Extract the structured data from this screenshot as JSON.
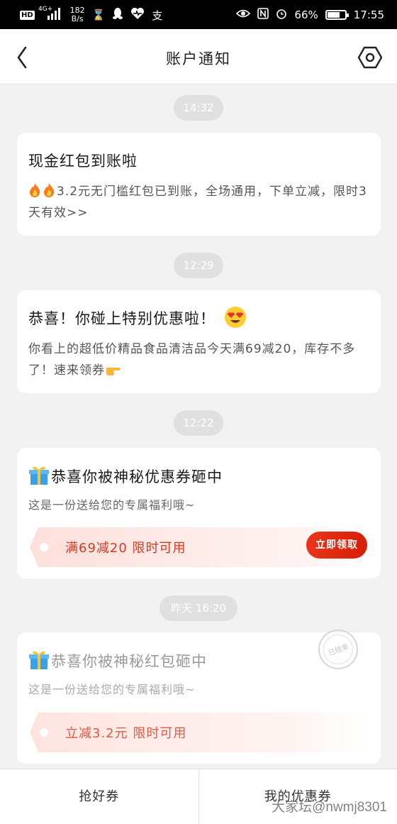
{
  "status_bar": {
    "hd": "HD",
    "network": "4G+",
    "speed_value": "182",
    "speed_unit": "B/s",
    "alipay": "支",
    "battery_text": "66%",
    "battery_level": 0.66,
    "time": "17:55"
  },
  "nav": {
    "title": "账户通知"
  },
  "messages": [
    {
      "time": "14:32",
      "title": "现金红包到账啦",
      "body": "3.2元无门槛红包已到账，全场通用，下单立减，限时3天有效>>"
    },
    {
      "time": "12:29",
      "title": "恭喜！你碰上特别优惠啦！",
      "body": "你看上的超低价精品食品清洁品今天满69减20，库存不多了！速来领券"
    },
    {
      "time": "12:22",
      "title": "恭喜你被神秘优惠券砸中",
      "body": "这是一份送给您的专属福利哦~",
      "coupon": "满69减20 限时可用",
      "button": "立即领取"
    },
    {
      "time": "昨天 16:20",
      "title": "恭喜你被神秘红包砸中",
      "body": "这是一份送给您的专属福利哦~",
      "coupon": "立减3.2元 限时可用",
      "stamp": "已结束"
    }
  ],
  "tabs": [
    "抢好券",
    "我的优惠券"
  ],
  "watermark": "大家坛@nwmj8301",
  "colors": {
    "accent_red": "#d81e06",
    "coupon_text": "#d43a20",
    "expired_coupon_text": "#e05a44"
  }
}
